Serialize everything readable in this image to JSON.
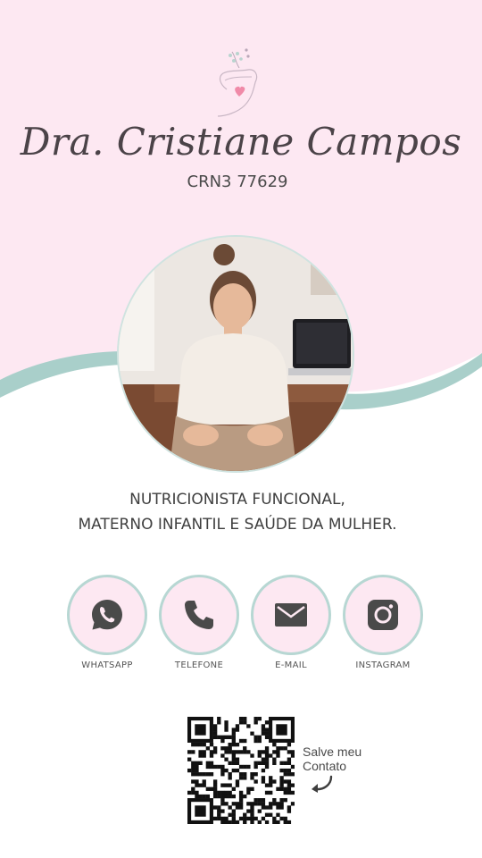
{
  "header": {
    "name": "Dra. Cristiane Campos",
    "crn": "CRN3 77629",
    "logo_icon": "hand-heart-logo-icon"
  },
  "profile": {
    "photo_icon": "profile-photo"
  },
  "tagline": {
    "line1": "NUTRICIONISTA FUNCIONAL,",
    "line2": "MATERNO INFANTIL E SAÚDE DA MULHER."
  },
  "contacts": [
    {
      "label": "WHATSAPP",
      "icon": "whatsapp-icon"
    },
    {
      "label": "TELEFONE",
      "icon": "phone-icon"
    },
    {
      "label": "E-MAIL",
      "icon": "email-icon"
    },
    {
      "label": "INSTAGRAM",
      "icon": "instagram-icon"
    }
  ],
  "save_contact": {
    "line1": "Salve meu",
    "line2": "Contato",
    "qr_icon": "qr-code-icon",
    "arrow_icon": "curved-arrow-icon"
  },
  "colors": {
    "pink_bg": "#fde8f2",
    "teal_wave": "#a9cfca",
    "text_dark": "#4b4348",
    "circle_border": "#b7d7d3"
  }
}
